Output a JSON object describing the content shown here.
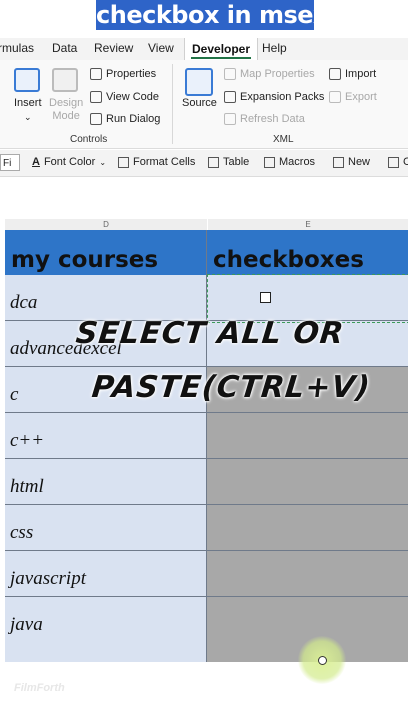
{
  "banner": {
    "text": "checkbox in msexcel"
  },
  "tabs": [
    {
      "label": "rmulas"
    },
    {
      "label": "Data"
    },
    {
      "label": "Review"
    },
    {
      "label": "View"
    },
    {
      "label": "Developer"
    },
    {
      "label": "Help"
    }
  ],
  "ribbon": {
    "insert": "Insert",
    "design_mode": "Design Mode",
    "properties": "Properties",
    "view_code": "View Code",
    "run_dialog": "Run Dialog",
    "controls_label": "Controls",
    "source": "Source",
    "map_properties": "Map Properties",
    "expansion_packs": "Expansion Packs",
    "refresh_data": "Refresh Data",
    "import": "Import",
    "export": "Export",
    "xml_label": "XML"
  },
  "qbar": {
    "font_select": "Fi",
    "font_color": "Font Color",
    "format_cells": "Format Cells",
    "table": "Table",
    "macros": "Macros",
    "new": "New",
    "trailing": "C"
  },
  "sheet": {
    "col_d": "D",
    "col_e": "E",
    "header_courses": "my  courses",
    "header_checkboxes": "checkboxes",
    "rows": [
      "dca",
      "advancedexcel",
      "c",
      "c++",
      "html",
      "css",
      "javascript",
      "java"
    ]
  },
  "overlay": {
    "line1": "SELECT ALL OR",
    "line2": "PASTE(CTRL+V)"
  },
  "watermark": "FilmForth"
}
